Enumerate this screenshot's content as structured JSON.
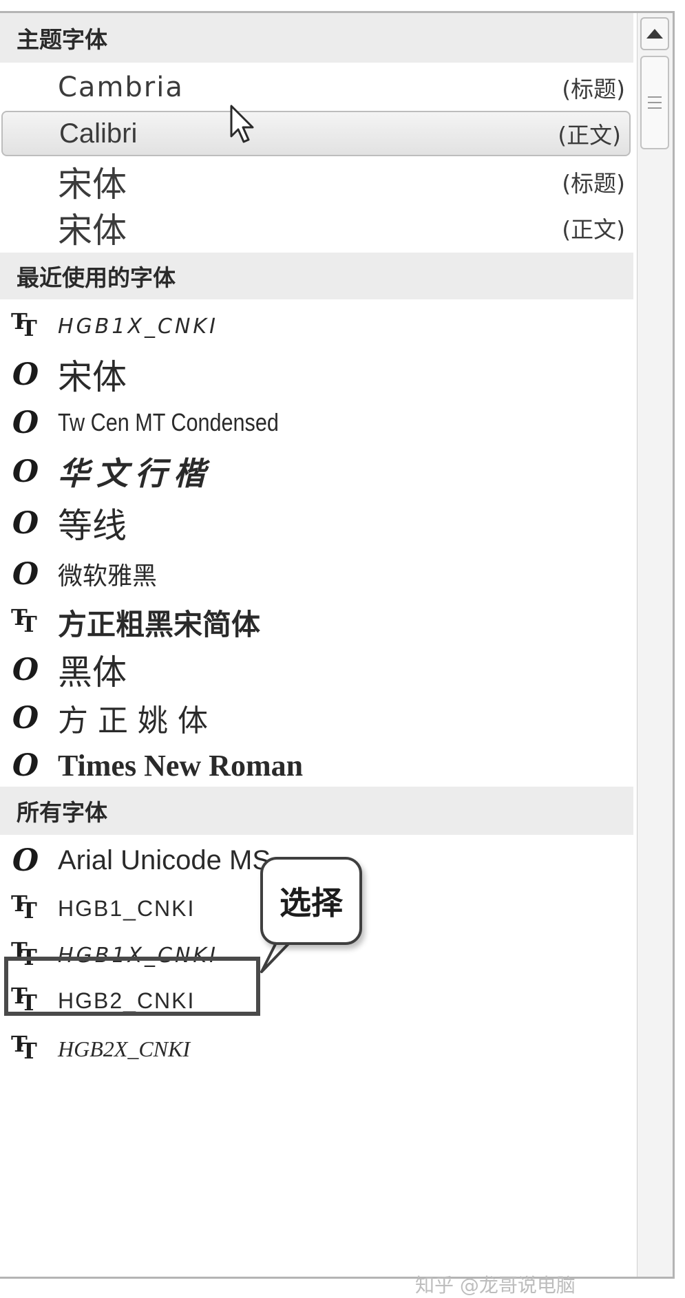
{
  "sections": {
    "theme": "主题字体",
    "recent": "最近使用的字体",
    "all": "所有字体"
  },
  "theme_fonts": [
    {
      "name": "Cambria",
      "tag": "(标题)"
    },
    {
      "name": "Calibri",
      "tag": "(正文)"
    },
    {
      "name": "宋体",
      "tag": "(标题)"
    },
    {
      "name": "宋体",
      "tag": "(正文)"
    }
  ],
  "recent_fonts": [
    {
      "icon": "truetype-icon",
      "name": "HGB1X_CNKI"
    },
    {
      "icon": "opentype-icon",
      "name": "宋体"
    },
    {
      "icon": "opentype-icon",
      "name": "Tw Cen MT Condensed"
    },
    {
      "icon": "opentype-icon",
      "name": "华文行楷"
    },
    {
      "icon": "opentype-icon",
      "name": "等线"
    },
    {
      "icon": "opentype-icon",
      "name": "微软雅黑"
    },
    {
      "icon": "truetype-icon",
      "name": "方正粗黑宋简体"
    },
    {
      "icon": "opentype-icon",
      "name": "黑体"
    },
    {
      "icon": "opentype-icon",
      "name": "方正姚体"
    },
    {
      "icon": "opentype-icon",
      "name": "Times New Roman"
    }
  ],
  "all_fonts": [
    {
      "icon": "opentype-icon",
      "name": "Arial Unicode MS"
    },
    {
      "icon": "truetype-icon",
      "name": "HGB1_CNKI"
    },
    {
      "icon": "truetype-icon",
      "name": "HGB1X_CNKI"
    },
    {
      "icon": "truetype-icon",
      "name": "HGB2_CNKI"
    },
    {
      "icon": "truetype-icon",
      "name": "HGB2X_CNKI"
    }
  ],
  "callout": "选择",
  "watermark": "知乎 @龙哥说电脑",
  "colors": {
    "header_bg": "#ececec",
    "selected_row_bg": "#e6e6e6",
    "border": "#b4b4b4",
    "highlight_box": "#4a4a4a"
  }
}
